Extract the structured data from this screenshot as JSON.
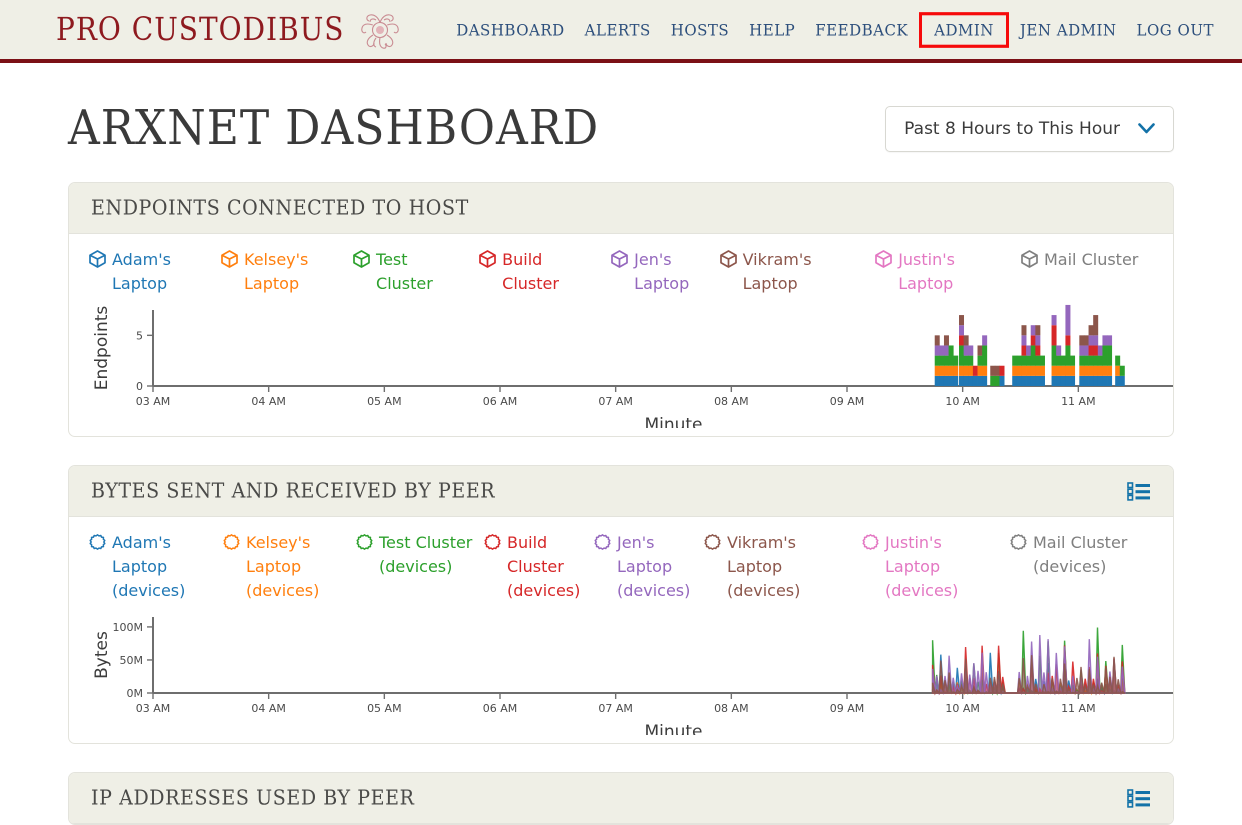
{
  "brand": {
    "name": "PRO CUSTODIBUS",
    "logo_icon": "medusa-head-icon"
  },
  "nav": {
    "items": [
      {
        "label": "DASHBOARD",
        "highlighted": false
      },
      {
        "label": "ALERTS",
        "highlighted": false
      },
      {
        "label": "HOSTS",
        "highlighted": false
      },
      {
        "label": "HELP",
        "highlighted": false
      },
      {
        "label": "FEEDBACK",
        "highlighted": false
      },
      {
        "label": "ADMIN",
        "highlighted": true
      },
      {
        "label": "JEN ADMIN",
        "highlighted": false
      },
      {
        "label": "LOG OUT",
        "highlighted": false
      }
    ],
    "highlight_color": "#f60a0a",
    "link_color": "#2d4f7c"
  },
  "page": {
    "title": "ARXNET DASHBOARD"
  },
  "range_select": {
    "value": "Past 8 Hours to This Hour",
    "chevron_icon": "chevron-down-icon",
    "chevron_color": "#1372a8"
  },
  "panels": {
    "endpoints": {
      "title": "ENDPOINTS CONNECTED TO HOST",
      "legend": [
        {
          "label": "Adam's Laptop",
          "color": "#1f77b4",
          "icon": "cube-icon"
        },
        {
          "label": "Kelsey's Laptop",
          "color": "#ff7f0e",
          "icon": "cube-icon"
        },
        {
          "label": "Test Cluster",
          "color": "#2ca02c",
          "icon": "cube-icon"
        },
        {
          "label": "Build Cluster",
          "color": "#d62728",
          "icon": "cube-icon"
        },
        {
          "label": "Jen's Laptop",
          "color": "#9467bd",
          "icon": "cube-icon"
        },
        {
          "label": "Vikram's Laptop",
          "color": "#8c564b",
          "icon": "cube-icon"
        },
        {
          "label": "Justin's Laptop",
          "color": "#e377c2",
          "icon": "cube-icon"
        },
        {
          "label": "Mail Cluster",
          "color": "#7f7f7f",
          "icon": "cube-icon"
        }
      ]
    },
    "bytes": {
      "title": "BYTES SENT AND RECEIVED BY PEER",
      "list_icon": "list-icon",
      "legend": [
        {
          "label": "Adam's Laptop (devices)",
          "color": "#1f77b4",
          "icon": "cog-ring-icon"
        },
        {
          "label": "Kelsey's Laptop (devices)",
          "color": "#ff7f0e",
          "icon": "cog-ring-icon"
        },
        {
          "label": "Test Cluster (devices)",
          "color": "#2ca02c",
          "icon": "cog-ring-icon"
        },
        {
          "label": "Build Cluster (devices)",
          "color": "#d62728",
          "icon": "cog-ring-icon"
        },
        {
          "label": "Jen's Laptop (devices)",
          "color": "#9467bd",
          "icon": "cog-ring-icon"
        },
        {
          "label": "Vikram's Laptop (devices)",
          "color": "#8c564b",
          "icon": "cog-ring-icon"
        },
        {
          "label": "Justin's Laptop (devices)",
          "color": "#e377c2",
          "icon": "cog-ring-icon"
        },
        {
          "label": "Mail Cluster (devices)",
          "color": "#7f7f7f",
          "icon": "cog-ring-icon"
        }
      ]
    },
    "ips": {
      "title": "IP ADDRESSES USED BY PEER",
      "list_icon": "list-icon"
    }
  },
  "chart_data": [
    {
      "type": "bar",
      "id": "endpoints-chart",
      "title": "Endpoints connected to host",
      "xlabel": "Minute",
      "ylabel": "Endpoints",
      "stacked": true,
      "xtick_labels": [
        "03 AM",
        "04 AM",
        "05 AM",
        "06 AM",
        "07 AM",
        "08 AM",
        "09 AM",
        "10 AM",
        "11 AM"
      ],
      "ytick_labels": [
        "0",
        "5"
      ],
      "ytick_values": [
        0,
        5
      ],
      "ylim": [
        0,
        7.5
      ],
      "grid": false,
      "series": [
        {
          "name": "Adam's Laptop",
          "color": "#1f77b4"
        },
        {
          "name": "Kelsey's Laptop",
          "color": "#ff7f0e"
        },
        {
          "name": "Test Cluster",
          "color": "#2ca02c"
        },
        {
          "name": "Build Cluster",
          "color": "#d62728"
        },
        {
          "name": "Jen's Laptop",
          "color": "#9467bd"
        },
        {
          "name": "Vikram's Laptop",
          "color": "#8c564b"
        }
      ],
      "note": "Data present only from about 09:45 AM to 11:20 AM; earlier hours empty.",
      "bars": [
        {
          "x": 9.78,
          "v": [
            1,
            1,
            1,
            0,
            1,
            1
          ]
        },
        {
          "x": 9.82,
          "v": [
            1,
            1,
            1,
            0,
            1,
            0
          ]
        },
        {
          "x": 9.86,
          "v": [
            1,
            1,
            1,
            0,
            1,
            1
          ]
        },
        {
          "x": 9.9,
          "v": [
            1,
            1,
            2,
            0,
            0,
            0
          ]
        },
        {
          "x": 9.94,
          "v": [
            1,
            1,
            1,
            0,
            0,
            0
          ]
        },
        {
          "x": 9.99,
          "v": [
            1,
            1,
            2,
            1,
            1,
            1
          ]
        },
        {
          "x": 10.03,
          "v": [
            1,
            1,
            1,
            0,
            1,
            1
          ]
        },
        {
          "x": 10.07,
          "v": [
            1,
            1,
            1,
            0,
            1,
            0
          ]
        },
        {
          "x": 10.11,
          "v": [
            1,
            0,
            0,
            1,
            0,
            0
          ]
        },
        {
          "x": 10.15,
          "v": [
            1,
            1,
            1,
            0,
            0,
            1
          ]
        },
        {
          "x": 10.19,
          "v": [
            1,
            1,
            2,
            0,
            1,
            0
          ]
        },
        {
          "x": 10.26,
          "v": [
            0,
            0,
            1,
            0,
            0,
            1
          ]
        },
        {
          "x": 10.3,
          "v": [
            0,
            0,
            1,
            0,
            0,
            1
          ]
        },
        {
          "x": 10.34,
          "v": [
            1,
            0,
            0,
            1,
            0,
            0
          ]
        },
        {
          "x": 10.45,
          "v": [
            1,
            1,
            1,
            0,
            0,
            0
          ]
        },
        {
          "x": 10.49,
          "v": [
            1,
            1,
            1,
            0,
            0,
            0
          ]
        },
        {
          "x": 10.53,
          "v": [
            1,
            1,
            1,
            1,
            1,
            1
          ]
        },
        {
          "x": 10.57,
          "v": [
            1,
            1,
            1,
            0,
            1,
            0
          ]
        },
        {
          "x": 10.61,
          "v": [
            1,
            1,
            2,
            1,
            1,
            0
          ]
        },
        {
          "x": 10.65,
          "v": [
            1,
            1,
            1,
            1,
            1,
            1
          ]
        },
        {
          "x": 10.69,
          "v": [
            1,
            1,
            1,
            0,
            0,
            0
          ]
        },
        {
          "x": 10.79,
          "v": [
            1,
            1,
            2,
            2,
            1,
            0
          ]
        },
        {
          "x": 10.83,
          "v": [
            1,
            1,
            1,
            0,
            1,
            0
          ]
        },
        {
          "x": 10.87,
          "v": [
            1,
            1,
            1,
            0,
            0,
            0
          ]
        },
        {
          "x": 10.91,
          "v": [
            1,
            1,
            2,
            1,
            3,
            0
          ]
        },
        {
          "x": 10.95,
          "v": [
            1,
            1,
            1,
            0,
            0,
            0
          ]
        },
        {
          "x": 11.03,
          "v": [
            1,
            1,
            1,
            0,
            1,
            1
          ]
        },
        {
          "x": 11.07,
          "v": [
            1,
            1,
            1,
            0,
            1,
            1
          ]
        },
        {
          "x": 11.11,
          "v": [
            1,
            1,
            1,
            1,
            1,
            1
          ]
        },
        {
          "x": 11.15,
          "v": [
            1,
            1,
            1,
            1,
            1,
            2
          ]
        },
        {
          "x": 11.19,
          "v": [
            1,
            1,
            1,
            0,
            1,
            0
          ]
        },
        {
          "x": 11.23,
          "v": [
            1,
            1,
            2,
            0,
            1,
            0
          ]
        },
        {
          "x": 11.27,
          "v": [
            1,
            1,
            2,
            0,
            1,
            0
          ]
        },
        {
          "x": 11.34,
          "v": [
            1,
            1,
            1,
            0,
            0,
            0
          ]
        },
        {
          "x": 11.38,
          "v": [
            1,
            0,
            1,
            0,
            0,
            0
          ]
        }
      ]
    },
    {
      "type": "area",
      "id": "bytes-chart",
      "title": "Bytes sent and received by peer",
      "xlabel": "Minute",
      "ylabel": "Bytes",
      "xtick_labels": [
        "03 AM",
        "04 AM",
        "05 AM",
        "06 AM",
        "07 AM",
        "08 AM",
        "09 AM",
        "10 AM",
        "11 AM"
      ],
      "ytick_labels": [
        "0M",
        "50M",
        "100M"
      ],
      "ytick_values": [
        0,
        50000000,
        100000000
      ],
      "ylim": [
        0,
        115000000
      ],
      "grid": false,
      "note": "Spiky overlapping traces only between about 09:45 AM and 11:20 AM; earlier hours flat at zero.",
      "series": [
        {
          "name": "Adam's Laptop (devices)",
          "color": "#1f77b4",
          "peak": 62000000
        },
        {
          "name": "Kelsey's Laptop (devices)",
          "color": "#ff7f0e",
          "peak": 48000000
        },
        {
          "name": "Test Cluster (devices)",
          "color": "#2ca02c",
          "peak": 100000000
        },
        {
          "name": "Build Cluster (devices)",
          "color": "#d62728",
          "peak": 74000000
        },
        {
          "name": "Jen's Laptop (devices)",
          "color": "#9467bd",
          "peak": 96000000
        },
        {
          "name": "Vikram's Laptop (devices)",
          "color": "#8c564b",
          "peak": 70000000
        }
      ]
    }
  ]
}
